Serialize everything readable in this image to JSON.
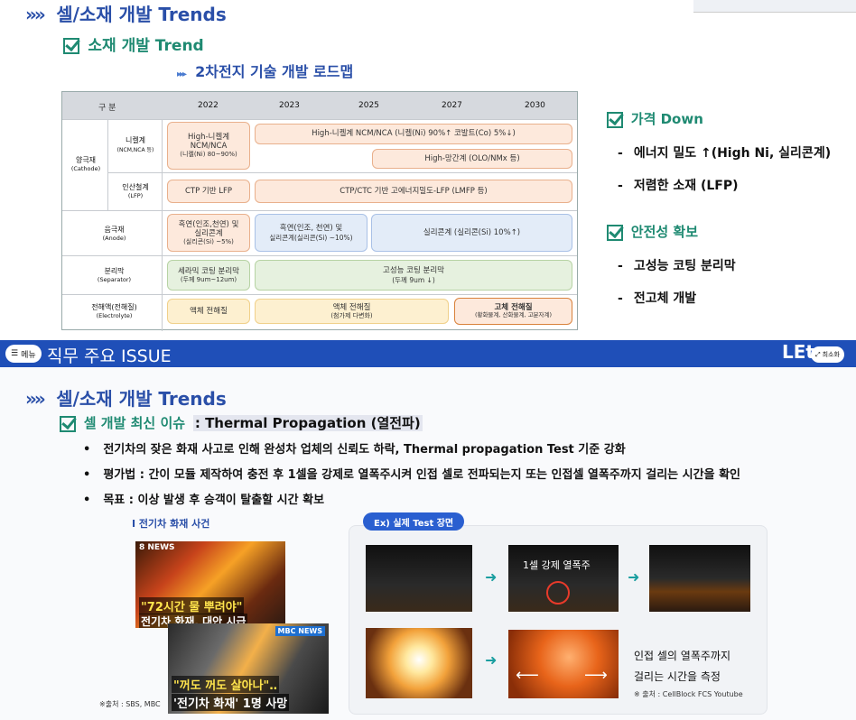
{
  "top": {
    "section_title": "셀/소재 개발 Trends",
    "sub_title": "소재 개발 Trend",
    "roadmap_title": "2차전지 기술 개발 로드맵"
  },
  "roadmap": {
    "header": [
      "구 분",
      "2022",
      "2023",
      "2025",
      "2027",
      "2030"
    ],
    "rows": {
      "cathode_label": "양극재",
      "cathode_sub": "(Cathode)",
      "ncm_label": "니켈계",
      "ncm_sub": "(NCM,NCA 등)",
      "lfp_label": "인산철계",
      "lfp_sub": "(LFP)",
      "anode_label": "음극재",
      "anode_sub": "(Anode)",
      "sep_label": "분리막",
      "sep_sub": "(Separator)",
      "elec_label": "전해액(전해질)",
      "elec_sub": "(Electrolyte)"
    },
    "cells": {
      "ncm_2022_a": "High-니켈계",
      "ncm_2022_b": "NCM/NCA",
      "ncm_2022_c": "(니켈(Ni) 80~90%)",
      "ncm_future": "High-니켈계 NCM/NCA (니켈(Ni) 90%↑ 코발트(Co) 5%↓)",
      "mn_future": "High-망간계 (OLO/NMx 등)",
      "lfp_2022": "CTP 기반 LFP",
      "lfp_future": "CTP/CTC 기반 고에너지밀도-LFP (LMFP 등)",
      "anode_2022_a": "흑연(인조,천연) 및",
      "anode_2022_b": "실리콘계",
      "anode_2022_c": "(실리콘(Si) ~5%)",
      "anode_2023_a": "흑연(인조, 천연) 및",
      "anode_2023_b": "실리콘계(실리콘(Si) ~10%)",
      "anode_future": "실리콘계 (실리콘(Si) 10%↑)",
      "sep_2022_a": "세라믹 코팅 분리막",
      "sep_2022_b": "(두께 9um~12um)",
      "sep_future_a": "고성능 코팅 분리막",
      "sep_future_b": "(두께 9um ↓)",
      "elec_2022": "액체 전해질",
      "elec_2023_a": "액체 전해질",
      "elec_2023_b": "(첨가제 다변화)",
      "elec_future_a": "고체 전해질",
      "elec_future_b": "(황화물계, 산화물계, 고분자계)"
    }
  },
  "right": {
    "price_title": "가격 Down",
    "price_items": [
      "에너지 밀도 ↑(High Ni, 실리콘계)",
      "저렴한 소재 (LFP)"
    ],
    "safety_title": "안전성 확보",
    "safety_items": [
      "고성능 코팅 분리막",
      "전고체 개발"
    ]
  },
  "bar": {
    "menu_label": "메뉴",
    "title": "직무 주요 ISSUE",
    "logo": "LEt",
    "exit_label": "최소화"
  },
  "bottom": {
    "section_title": "셀/소재 개발 Trends",
    "sub_title": "셀 개발 최신 이슈",
    "sub_title_b": ": Thermal Propagation (열전파)",
    "bullets": [
      "전기차의 잦은 화재 사고로 인해 완성차 업체의 신뢰도 하락, Thermal propagation Test 기준 강화",
      "평가법 : 간이 모듈 제작하여 충전 후 1셀을 강제로 열폭주시켜 인접 셀로 전파되는지 또는 인접셀 열폭주까지 걸리는 시간을 확인",
      "목표 : 이상 발생 후 승객이 탈출할 시간 확보"
    ],
    "ev_fire_title": "I 전기차 화재 사건",
    "news1_logo": "8 NEWS",
    "news1_caption_a": "\"72시간 물 뿌려야\"",
    "news1_caption_b": "전기차 화재, 대안 시급",
    "news2_logo": "MBC NEWS",
    "news2_caption_a": "\"꺼도 꺼도 살아나\"‥",
    "news2_caption_b": "'전기차 화재' 1명 사망",
    "news_source": "※출처 : SBS, MBC",
    "test_title": "Ex) 실제 Test 장면",
    "test_label_1": "1셀 강제 열폭주",
    "test_desc_a": "인접 셀의 열폭주까지",
    "test_desc_b": "걸리는 시간을 측정",
    "test_source": "※ 출처 : CellBlock FCS Youtube"
  }
}
